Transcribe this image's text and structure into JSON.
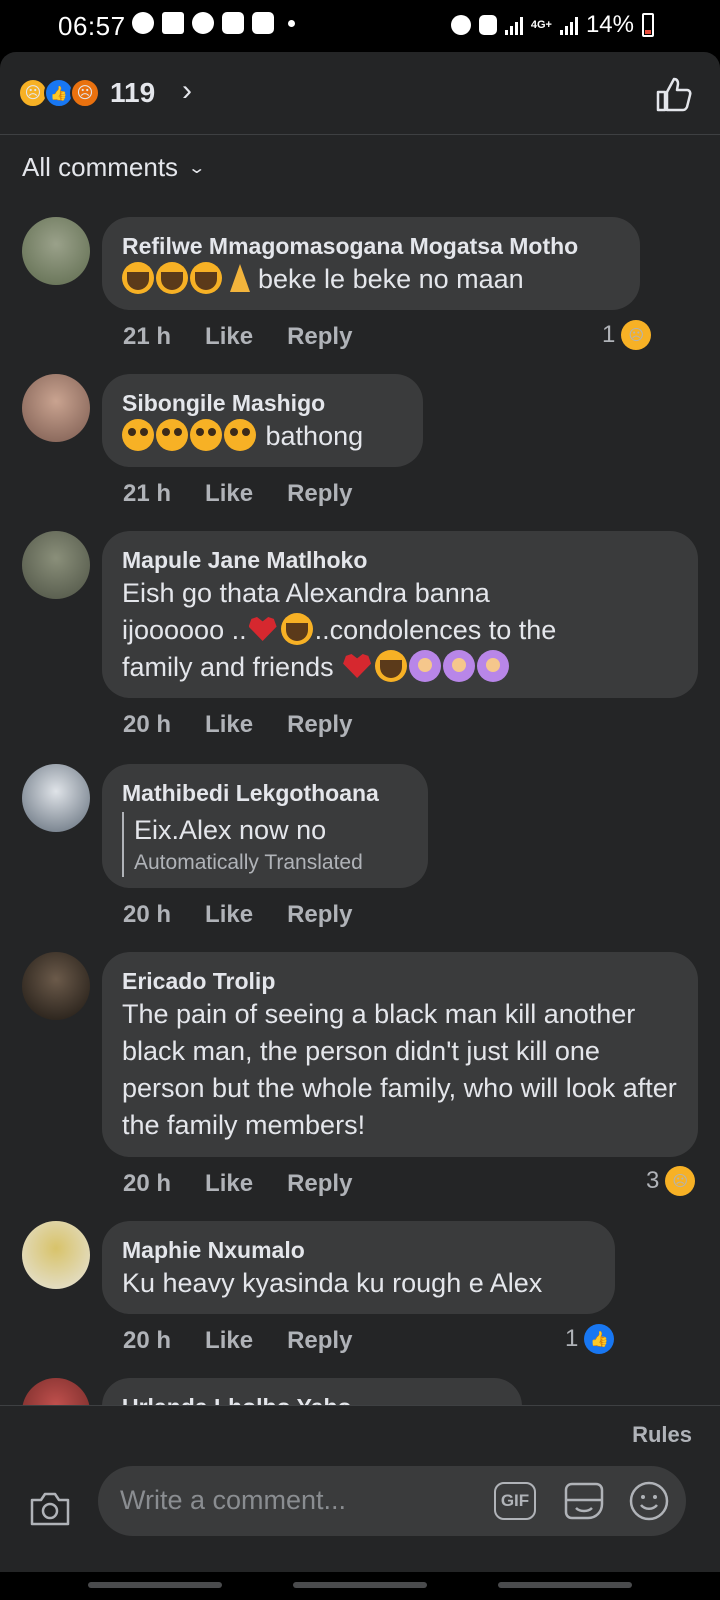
{
  "status_bar": {
    "time": "06:57",
    "net": "4G+",
    "battery": "14%",
    "icons": [
      "sync-icon",
      "twitter-icon",
      "account-icon",
      "calendar-icon",
      "messenger-icon",
      "alarm-icon",
      "mute-icon",
      "signal-icon",
      "battery-icon"
    ]
  },
  "reactions_header": {
    "count": "119",
    "reaction_icons": [
      "sad-reaction-icon",
      "like-reaction-icon",
      "angry-reaction-icon"
    ]
  },
  "filter": {
    "label": "All comments"
  },
  "comments": [
    {
      "author": "Refilwe Mmagomasogana Mogatsa Motho",
      "text": "beke le beke no maan",
      "emojis": [
        "crying-emoji",
        "crying-emoji",
        "crying-emoji",
        "praying-hands-emoji"
      ],
      "time": "21 h",
      "like": "Like",
      "reply": "Reply",
      "reaction_count": "1",
      "reaction": "sad"
    },
    {
      "author": "Sibongile Mashigo",
      "text": "bathong",
      "emojis": [
        "pleading-emoji",
        "pleading-emoji",
        "pleading-emoji",
        "pleading-emoji"
      ],
      "time": "21 h",
      "like": "Like",
      "reply": "Reply"
    },
    {
      "author": "Mapule Jane Matlhoko",
      "line1": "Eish go thata Alexandra  banna",
      "line2_a": "ijoooooo ..",
      "line2_b": "..condolences  to the",
      "line3": "family  and friends ",
      "time": "20 h",
      "like": "Like",
      "reply": "Reply"
    },
    {
      "author": "Mathibedi Lekgothoana",
      "text": "Eix.Alex now no",
      "translated_note": "Automatically Translated",
      "time": "20 h",
      "like": "Like",
      "reply": "Reply"
    },
    {
      "author": "Ericado Trolip",
      "text": "The pain of seeing  a  black man kill another  black man, the person  didn't just kill one person  but the whole  family, who will look after the  family  members!",
      "time": "20 h",
      "like": "Like",
      "reply": "Reply",
      "reaction_count": "3",
      "reaction": "sad"
    },
    {
      "author": "Maphie Nxumalo",
      "text": "Ku heavy kyasinda ku rough e Alex",
      "time": "20 h",
      "like": "Like",
      "reply": "Reply",
      "reaction_count": "1",
      "reaction": "like"
    },
    {
      "author": "Urlanda Lholbo Yabo"
    }
  ],
  "footer": {
    "rules": "Rules",
    "placeholder": "Write a comment...",
    "gif_label": "GIF"
  },
  "colors": {
    "panel_bg": "#242526",
    "bubble_bg": "#3a3b3c",
    "text_primary": "#e4e6eb",
    "text_secondary": "#b0b3b8",
    "like_blue": "#1877f2",
    "sad_yellow": "#f7b125"
  }
}
